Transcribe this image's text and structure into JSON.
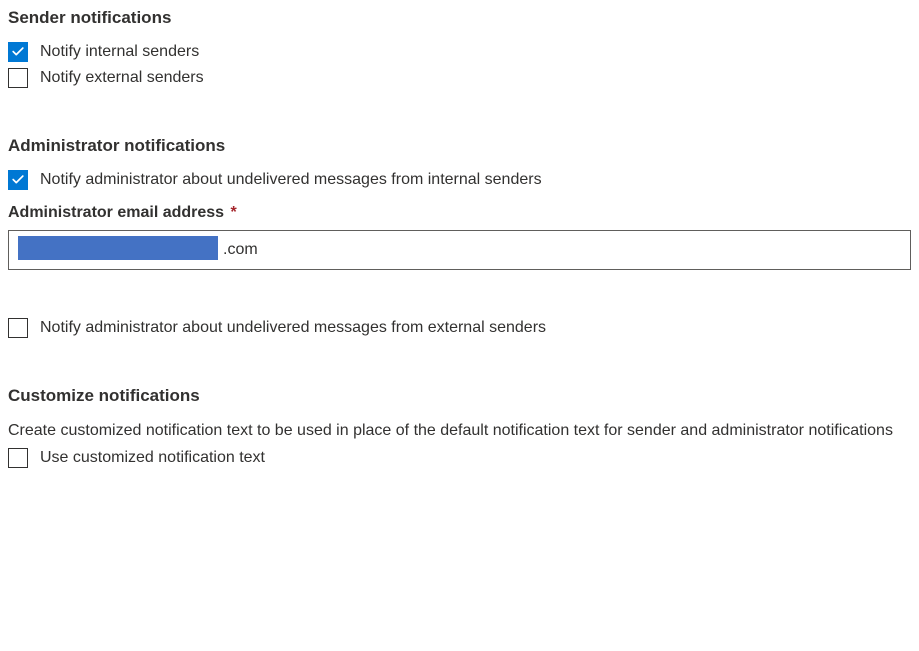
{
  "sender_notifications": {
    "heading": "Sender notifications",
    "notify_internal": {
      "label": "Notify internal senders",
      "checked": true
    },
    "notify_external": {
      "label": "Notify external senders",
      "checked": false
    }
  },
  "admin_notifications": {
    "heading": "Administrator notifications",
    "notify_internal": {
      "label": "Notify administrator about undelivered messages from internal senders",
      "checked": true
    },
    "email_field": {
      "label": "Administrator email address",
      "required_marker": "*",
      "value_visible_suffix": ".com"
    },
    "notify_external": {
      "label": "Notify administrator about undelivered messages from external senders",
      "checked": false
    }
  },
  "customize_notifications": {
    "heading": "Customize notifications",
    "description": "Create customized notification text to be used in place of the default notification text for sender and administrator notifications",
    "use_custom": {
      "label": "Use customized notification text",
      "checked": false
    }
  }
}
